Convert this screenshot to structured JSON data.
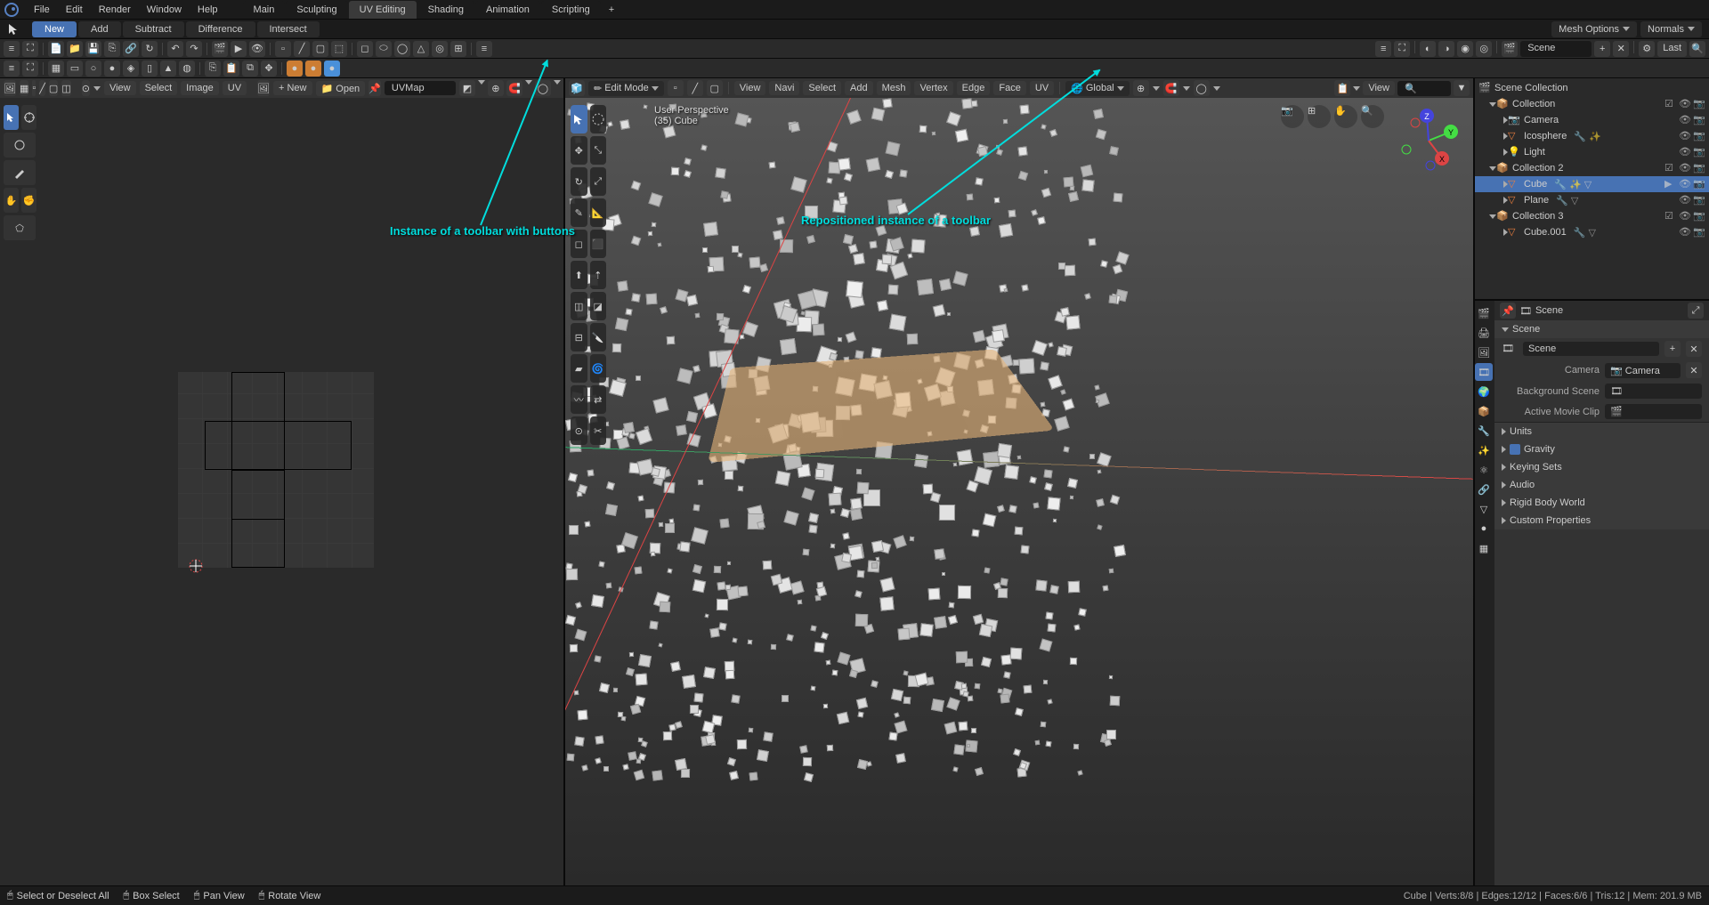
{
  "topmenu": {
    "file": "File",
    "edit": "Edit",
    "render": "Render",
    "window": "Window",
    "help": "Help"
  },
  "workspaces": {
    "main": "Main",
    "sculpting": "Sculpting",
    "uv": "UV Editing",
    "shading": "Shading",
    "animation": "Animation",
    "scripting": "Scripting"
  },
  "boolops": {
    "new": "New",
    "add": "Add",
    "subtract": "Subtract",
    "difference": "Difference",
    "intersect": "Intersect"
  },
  "topright": {
    "meshopts": "Mesh Options",
    "normals": "Normals"
  },
  "uvheader": {
    "view": "View",
    "select": "Select",
    "image": "Image",
    "uv": "UV",
    "new": "New",
    "open": "Open",
    "uvmap": "UVMap"
  },
  "vp": {
    "mode": "Edit Mode",
    "view": "View",
    "navi": "Navi",
    "select": "Select",
    "add": "Add",
    "mesh": "Mesh",
    "vertex": "Vertex",
    "edge": "Edge",
    "face": "Face",
    "uv": "UV",
    "global": "Global",
    "persp": "User Perspective",
    "obj": "(35) Cube"
  },
  "outliner": {
    "scene": "Scene",
    "last": "Last",
    "view": "View",
    "scenecol": "Scene Collection",
    "col1": "Collection",
    "camera": "Camera",
    "ico": "Icosphere",
    "light": "Light",
    "col2": "Collection 2",
    "cube": "Cube",
    "plane": "Plane",
    "col3": "Collection 3",
    "cube001": "Cube.001"
  },
  "props": {
    "scene": "Scene",
    "scenehdr": "Scene",
    "camera_lbl": "Camera",
    "camera_val": "Camera",
    "bgscene_lbl": "Background Scene",
    "clip_lbl": "Active Movie Clip",
    "units": "Units",
    "gravity": "Gravity",
    "keying": "Keying Sets",
    "audio": "Audio",
    "rigid": "Rigid Body World",
    "custom": "Custom Properties"
  },
  "status": {
    "select": "Select or Deselect All",
    "box": "Box Select",
    "pan": "Pan View",
    "rotate": "Rotate View",
    "stats": "Cube | Verts:8/8 | Edges:12/12 | Faces:6/6 | Tris:12 | Mem: 201.9 MB"
  },
  "annot": {
    "a1": "Instance of a toolbar with buttons",
    "a2": "Repositioned instance of a toolbar"
  }
}
